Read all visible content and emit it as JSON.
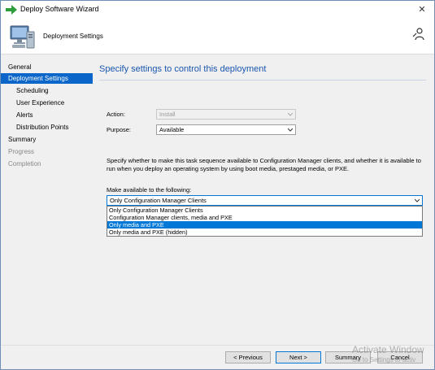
{
  "window": {
    "title": "Deploy Software Wizard",
    "close_glyph": "✕"
  },
  "header": {
    "title": "Deployment Settings",
    "icon": "computer-icon",
    "help_icon": "help-person-icon"
  },
  "nav": {
    "items": [
      {
        "label": "General",
        "state": "normal",
        "level": 0
      },
      {
        "label": "Deployment Settings",
        "state": "active",
        "level": 0
      },
      {
        "label": "Scheduling",
        "state": "normal",
        "level": 1
      },
      {
        "label": "User Experience",
        "state": "normal",
        "level": 1
      },
      {
        "label": "Alerts",
        "state": "normal",
        "level": 1
      },
      {
        "label": "Distribution Points",
        "state": "normal",
        "level": 1
      },
      {
        "label": "Summary",
        "state": "normal",
        "level": 0
      },
      {
        "label": "Progress",
        "state": "disabled",
        "level": 0
      },
      {
        "label": "Completion",
        "state": "disabled",
        "level": 0
      }
    ]
  },
  "content": {
    "title": "Specify settings to control this deployment",
    "action_label": "Action:",
    "action_value": "Install",
    "purpose_label": "Purpose:",
    "purpose_value": "Available",
    "description": "Specify whether to make this task sequence available to Configuration Manager clients, and whether it is available to run when you deploy an operating system by using boot media, prestaged media, or PXE.",
    "make_available_label": "Make available to the following:",
    "make_available_value": "Only Configuration Manager Clients",
    "options": [
      {
        "label": "Only Configuration Manager Clients",
        "selected": false
      },
      {
        "label": "Configuration Manager clients, media and PXE",
        "selected": false
      },
      {
        "label": "Only media and PXE",
        "selected": true
      },
      {
        "label": "Only media and PXE (hidden)",
        "selected": false
      }
    ]
  },
  "footer": {
    "previous_label": "< Previous",
    "next_label": "Next >",
    "summary_label": "Summary",
    "cancel_label": "Cancel"
  },
  "watermark": {
    "line1": "Activate Window",
    "line2": "Go to Settings to activ"
  },
  "colors": {
    "accent": "#0078d7",
    "nav_active": "#0a66c8",
    "title_blue": "#1a56b0"
  }
}
